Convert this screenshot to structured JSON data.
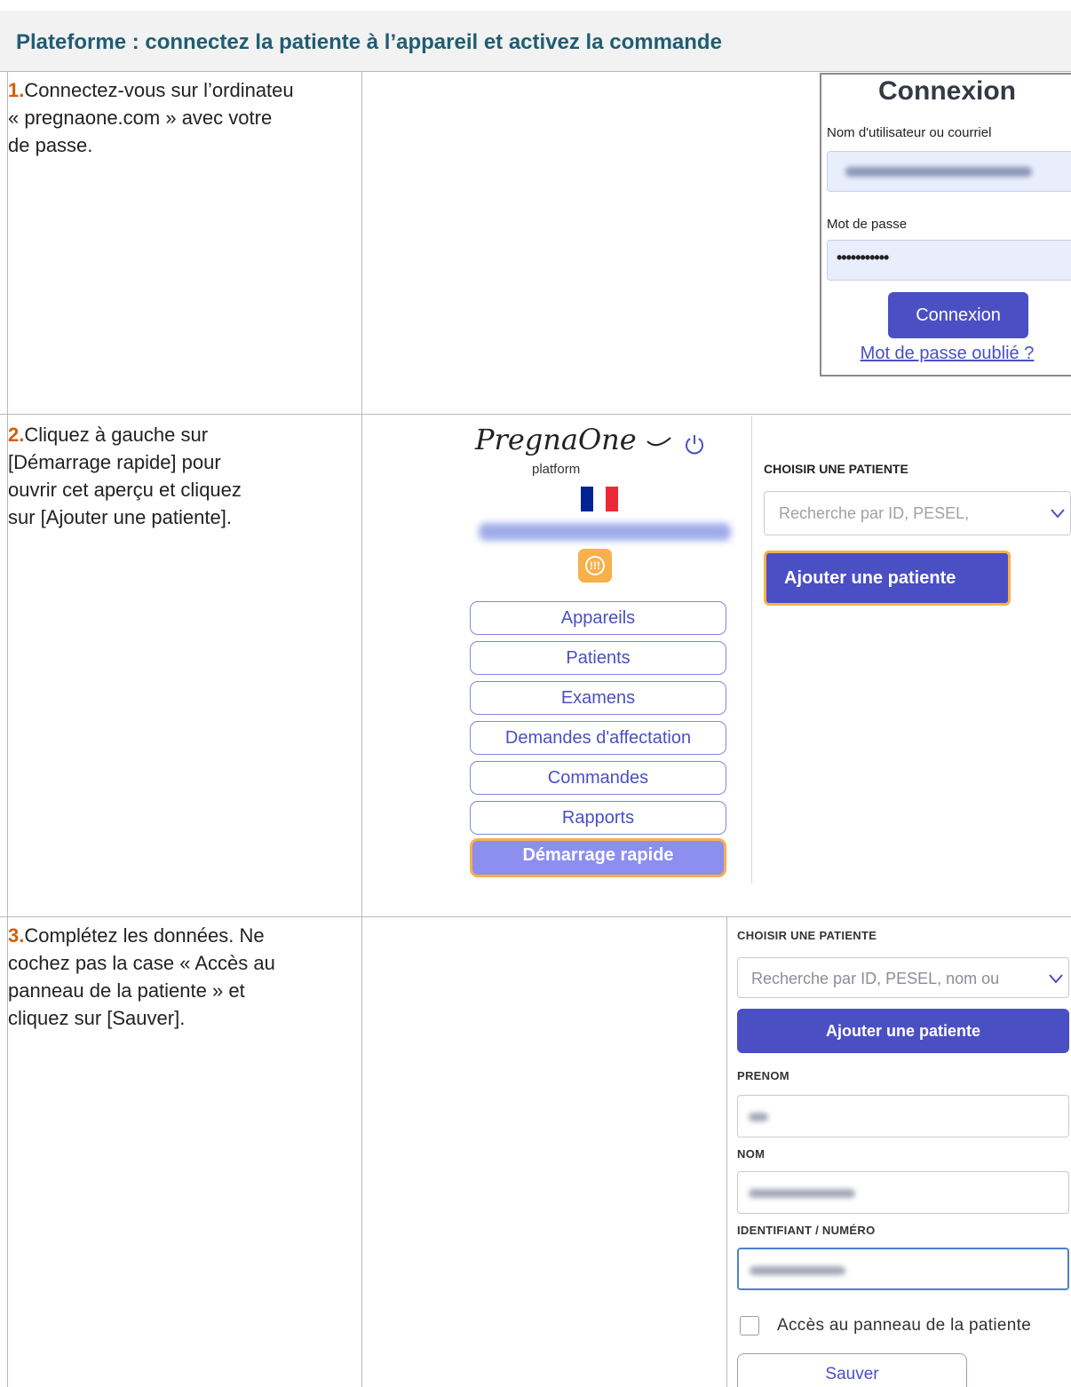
{
  "title": "Plateforme : connectez la patiente à l’appareil et activez la commande",
  "steps": [
    {
      "num": "1.",
      "lines": [
        "Connectez-vous sur l’ordinateu",
        "« pregnaone.com » avec votre",
        "de passe."
      ]
    },
    {
      "num": "2.",
      "lines": [
        "Cliquez à gauche sur",
        "[Démarrage rapide] pour",
        "ouvrir cet aperçu et cliquez",
        "sur [Ajouter une patiente]."
      ]
    },
    {
      "num": "3.",
      "lines": [
        "Complétez les données. Ne",
        "cochez pas la case « Accès au",
        "panneau de la patiente » et",
        "cliquez sur [Sauver]."
      ]
    }
  ],
  "login": {
    "title": "Connexion",
    "username_label": "Nom d'utilisateur ou courriel",
    "password_label": "Mot de passe",
    "password_value": "•••••••••••",
    "button": "Connexion",
    "forgot_link": "Mot de passe oublié ?"
  },
  "platform": {
    "logo": "PregnaOne",
    "logo_sub": "platform",
    "alert_symbol": "!!!",
    "flag_colors": [
      "#002395",
      "#ffffff",
      "#ed2939"
    ],
    "menu": [
      {
        "label": "Appareils",
        "active": false
      },
      {
        "label": "Patients",
        "active": false
      },
      {
        "label": "Examens",
        "active": false
      },
      {
        "label": "Demandes d'affectation",
        "active": false
      },
      {
        "label": "Commandes",
        "active": false
      },
      {
        "label": "Rapports",
        "active": false
      },
      {
        "label": "Démarrage rapide",
        "active": true
      }
    ],
    "choose_label": "CHOISIR UNE PATIENTE",
    "search_placeholder": "Recherche par ID, PESEL,",
    "add_button": "Ajouter une patiente"
  },
  "form": {
    "choose_label": "CHOISIR UNE PATIENTE",
    "search_placeholder": "Recherche par ID, PESEL, nom ou",
    "add_button": "Ajouter une patiente",
    "firstname_label": "PRENOM",
    "lastname_label": "NOM",
    "id_label": "IDENTIFIANT / NUMÉRO",
    "access_label": "Accès au panneau de la patiente",
    "access_checked": false,
    "save_button": "Sauver"
  },
  "colors": {
    "title": "#1f5d74",
    "step_number": "#d35f0a",
    "primary": "#4b4fc4",
    "highlight": "#f7b04a"
  }
}
